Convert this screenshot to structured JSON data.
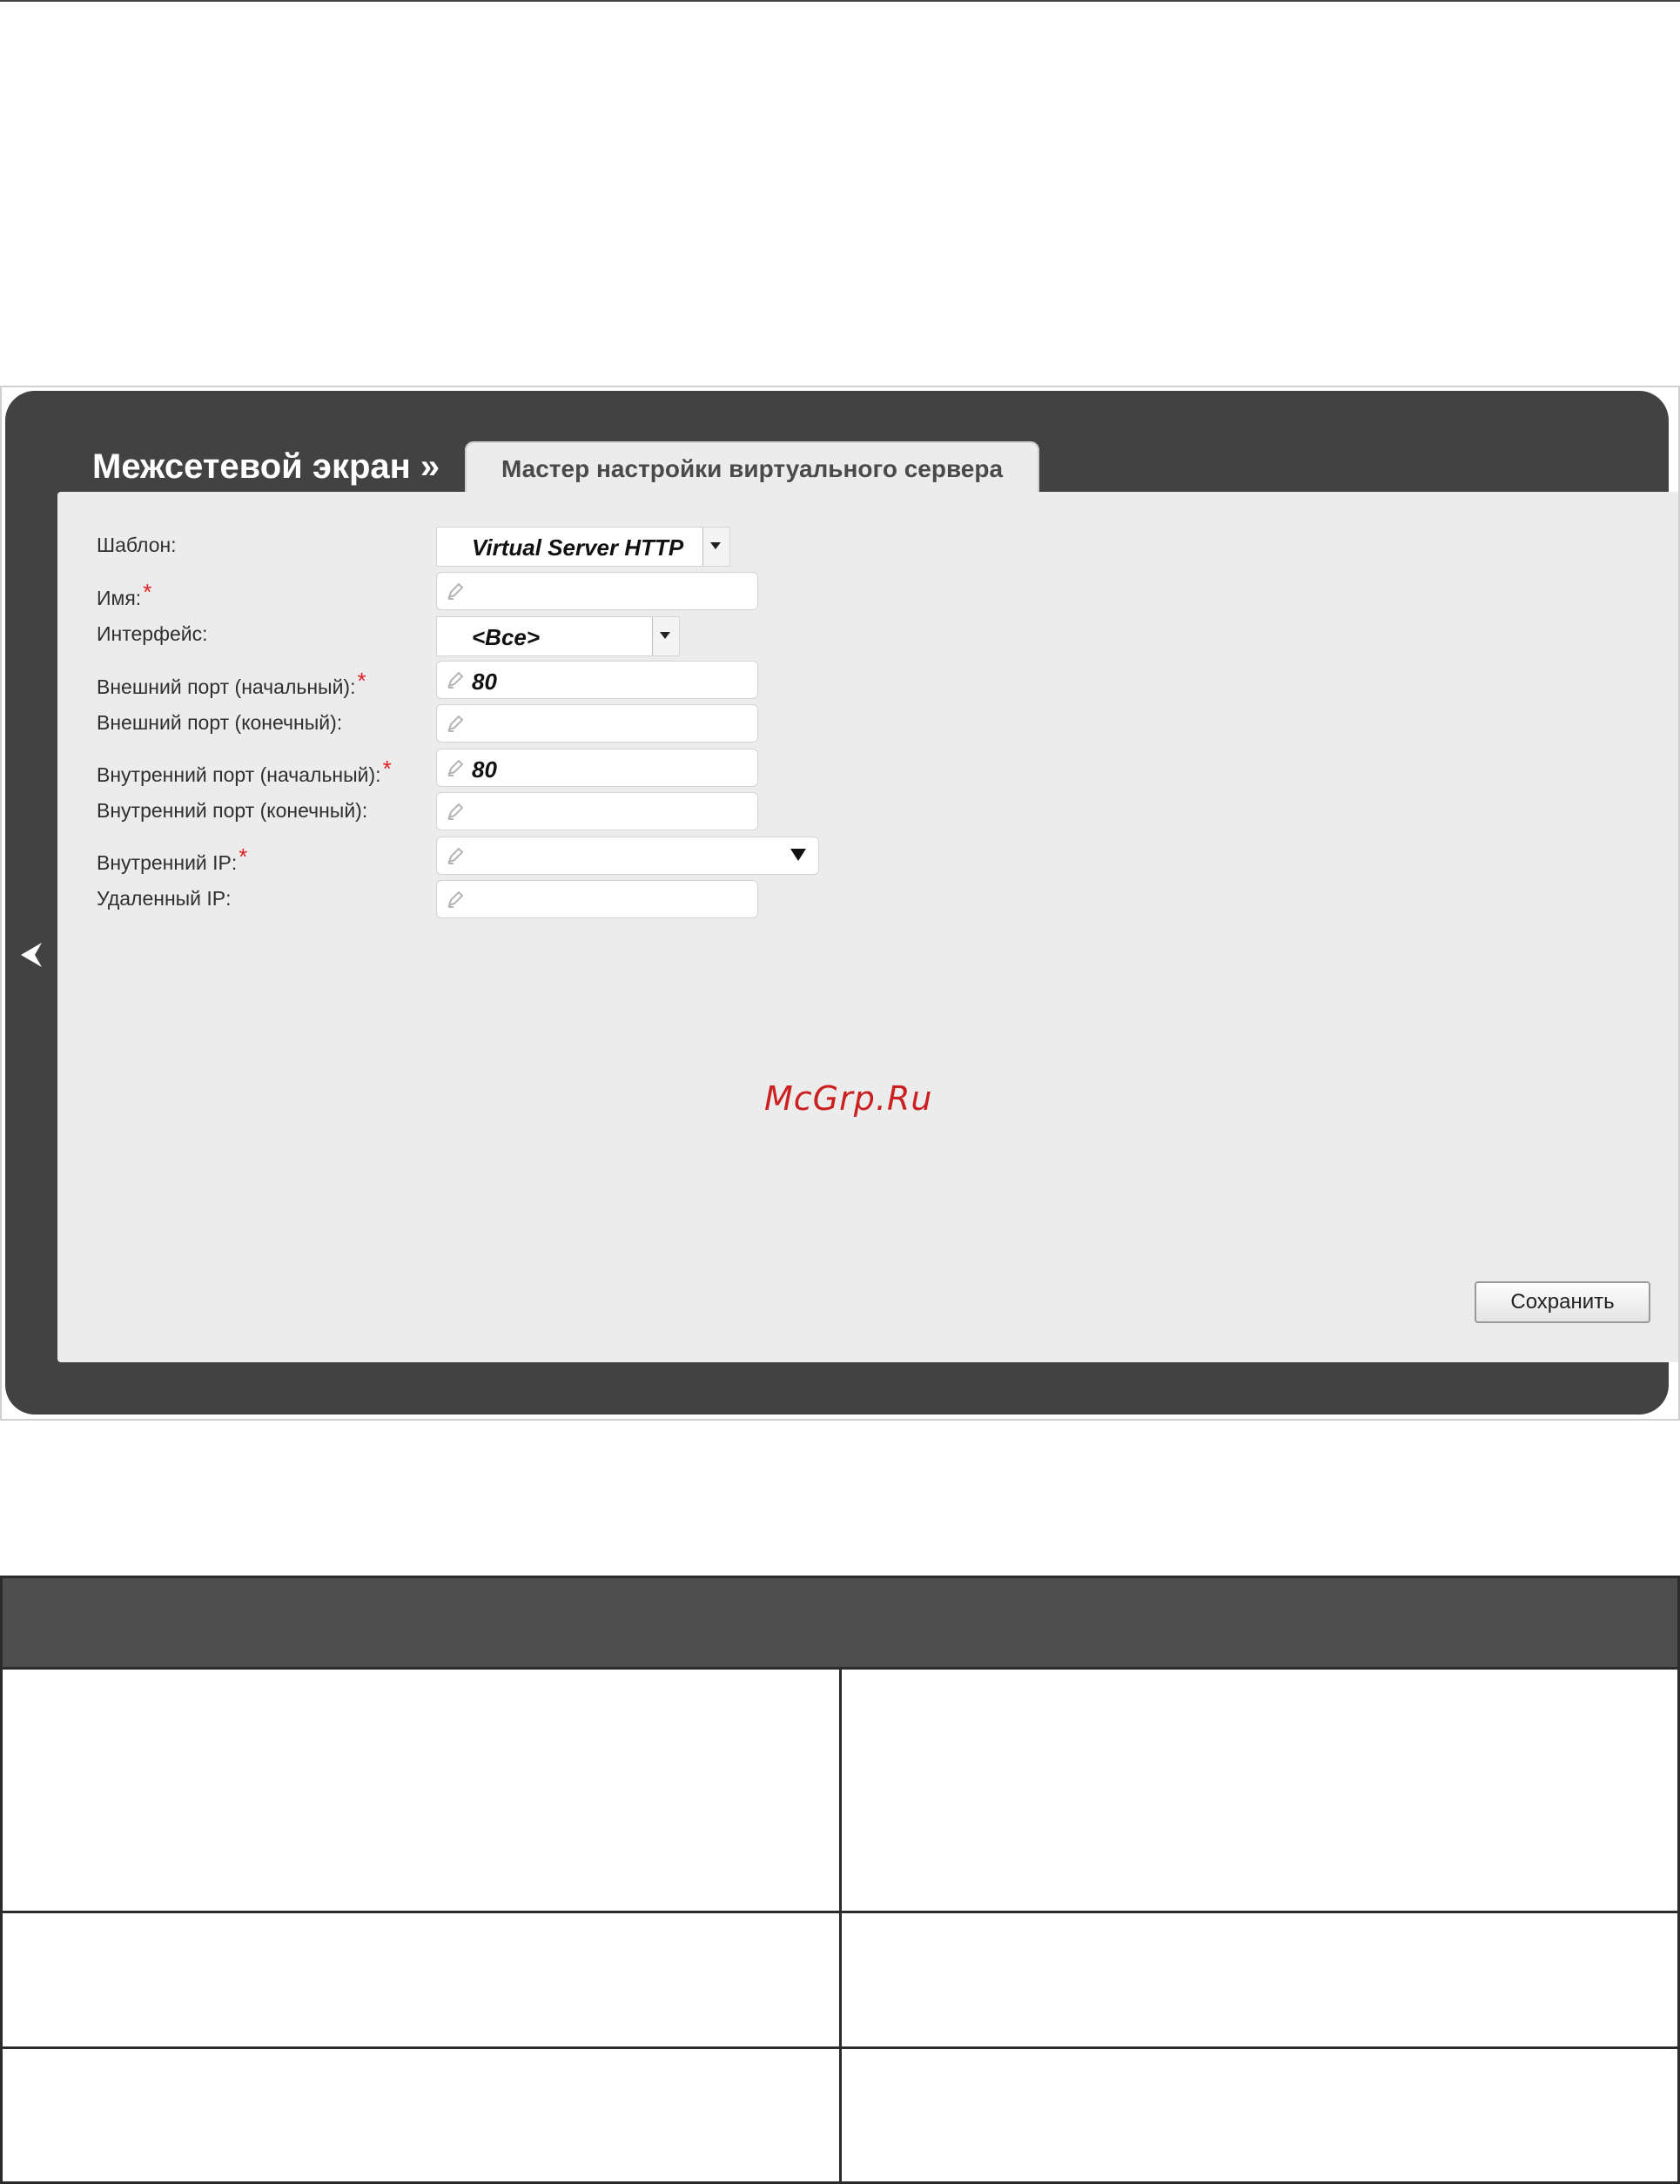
{
  "app": {
    "section_title": "Межсетевой экран »",
    "tab_label": "Мастер настройки виртуального сервера",
    "watermark": "McGrp.Ru"
  },
  "form": {
    "template": {
      "label": "Шаблон:",
      "value": "Virtual Server HTTP"
    },
    "name": {
      "label": "Имя:",
      "required": "*",
      "value": ""
    },
    "interface": {
      "label": "Интерфейс:",
      "value": "<Все>"
    },
    "ext_port_start": {
      "label": "Внешний порт (начальный):",
      "required": "*",
      "value": "80"
    },
    "ext_port_end": {
      "label": "Внешний порт (конечный):",
      "value": ""
    },
    "int_port_start": {
      "label": "Внутренний порт (начальный):",
      "required": "*",
      "value": "80"
    },
    "int_port_end": {
      "label": "Внутренний порт (конечный):",
      "value": ""
    },
    "internal_ip": {
      "label": "Внутренний IP:",
      "required": "*",
      "value": ""
    },
    "remote_ip": {
      "label": "Удаленный IP:",
      "value": ""
    }
  },
  "buttons": {
    "save": "Сохранить"
  },
  "colors": {
    "frame_dark": "#424242",
    "panel_bg": "#ececec",
    "required_star": "#e02020",
    "watermark": "#cc2020",
    "table_header": "#4d4d4d"
  },
  "icons": [
    "back-arrow-icon",
    "pencil-icon",
    "dropdown-arrow-icon"
  ]
}
